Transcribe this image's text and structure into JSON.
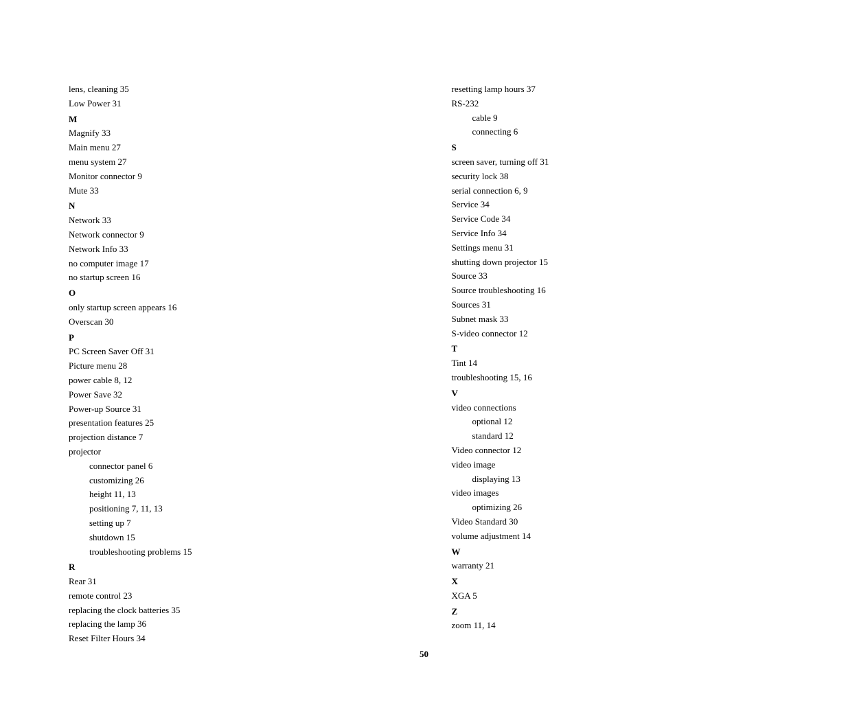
{
  "page": {
    "number": "50"
  },
  "left_column": [
    {
      "text": "lens, cleaning 35",
      "type": "normal"
    },
    {
      "text": "Low Power 31",
      "type": "normal"
    },
    {
      "text": "M",
      "type": "letter-heading"
    },
    {
      "text": "Magnify 33",
      "type": "normal"
    },
    {
      "text": "Main menu 27",
      "type": "normal"
    },
    {
      "text": "menu system 27",
      "type": "normal"
    },
    {
      "text": "Monitor connector 9",
      "type": "normal"
    },
    {
      "text": "Mute 33",
      "type": "normal"
    },
    {
      "text": "N",
      "type": "letter-heading"
    },
    {
      "text": "Network 33",
      "type": "normal"
    },
    {
      "text": "Network connector 9",
      "type": "normal"
    },
    {
      "text": "Network Info 33",
      "type": "normal"
    },
    {
      "text": "no computer image 17",
      "type": "normal"
    },
    {
      "text": "no startup screen 16",
      "type": "normal"
    },
    {
      "text": "O",
      "type": "letter-heading"
    },
    {
      "text": "only startup screen appears 16",
      "type": "normal"
    },
    {
      "text": "Overscan 30",
      "type": "normal"
    },
    {
      "text": "P",
      "type": "letter-heading"
    },
    {
      "text": "PC Screen Saver Off 31",
      "type": "normal"
    },
    {
      "text": "Picture menu 28",
      "type": "normal"
    },
    {
      "text": "power cable 8, 12",
      "type": "normal"
    },
    {
      "text": "Power Save 32",
      "type": "normal"
    },
    {
      "text": "Power-up Source 31",
      "type": "normal"
    },
    {
      "text": "presentation features 25",
      "type": "normal"
    },
    {
      "text": "projection distance 7",
      "type": "normal"
    },
    {
      "text": "projector",
      "type": "normal"
    },
    {
      "text": "connector panel 6",
      "type": "sub-entry"
    },
    {
      "text": "customizing 26",
      "type": "sub-entry"
    },
    {
      "text": "height 11, 13",
      "type": "sub-entry"
    },
    {
      "text": "positioning 7, 11, 13",
      "type": "sub-entry"
    },
    {
      "text": "setting up 7",
      "type": "sub-entry"
    },
    {
      "text": "shutdown 15",
      "type": "sub-entry"
    },
    {
      "text": "troubleshooting problems 15",
      "type": "sub-entry"
    },
    {
      "text": "R",
      "type": "letter-heading"
    },
    {
      "text": "Rear 31",
      "type": "normal"
    },
    {
      "text": "remote control 23",
      "type": "normal"
    },
    {
      "text": "replacing the clock batteries 35",
      "type": "normal"
    },
    {
      "text": "replacing the lamp 36",
      "type": "normal"
    },
    {
      "text": "Reset Filter Hours 34",
      "type": "normal"
    }
  ],
  "right_column": [
    {
      "text": "resetting lamp hours 37",
      "type": "normal"
    },
    {
      "text": "RS-232",
      "type": "normal"
    },
    {
      "text": "cable 9",
      "type": "sub-entry"
    },
    {
      "text": "connecting 6",
      "type": "sub-entry"
    },
    {
      "text": "S",
      "type": "letter-heading"
    },
    {
      "text": "screen saver, turning off 31",
      "type": "normal"
    },
    {
      "text": "security lock 38",
      "type": "normal"
    },
    {
      "text": "serial connection 6, 9",
      "type": "normal"
    },
    {
      "text": "Service 34",
      "type": "normal"
    },
    {
      "text": "Service Code 34",
      "type": "normal"
    },
    {
      "text": "Service Info 34",
      "type": "normal"
    },
    {
      "text": "Settings menu 31",
      "type": "normal"
    },
    {
      "text": "shutting down projector 15",
      "type": "normal"
    },
    {
      "text": "Source 33",
      "type": "normal"
    },
    {
      "text": "Source troubleshooting 16",
      "type": "normal"
    },
    {
      "text": "Sources 31",
      "type": "normal"
    },
    {
      "text": "Subnet mask 33",
      "type": "normal"
    },
    {
      "text": "S-video connector 12",
      "type": "normal"
    },
    {
      "text": "T",
      "type": "letter-heading"
    },
    {
      "text": "Tint 14",
      "type": "normal"
    },
    {
      "text": "troubleshooting 15, 16",
      "type": "normal"
    },
    {
      "text": "V",
      "type": "letter-heading"
    },
    {
      "text": "video connections",
      "type": "normal"
    },
    {
      "text": "optional 12",
      "type": "sub-entry"
    },
    {
      "text": "standard 12",
      "type": "sub-entry"
    },
    {
      "text": "Video connector 12",
      "type": "normal"
    },
    {
      "text": "video image",
      "type": "normal"
    },
    {
      "text": "displaying 13",
      "type": "sub-entry"
    },
    {
      "text": "video images",
      "type": "normal"
    },
    {
      "text": "optimizing 26",
      "type": "sub-entry"
    },
    {
      "text": "Video Standard 30",
      "type": "normal"
    },
    {
      "text": "volume adjustment 14",
      "type": "normal"
    },
    {
      "text": "W",
      "type": "letter-heading"
    },
    {
      "text": "warranty 21",
      "type": "normal"
    },
    {
      "text": "X",
      "type": "letter-heading"
    },
    {
      "text": "XGA 5",
      "type": "normal"
    },
    {
      "text": "Z",
      "type": "letter-heading"
    },
    {
      "text": "zoom 11, 14",
      "type": "normal"
    }
  ]
}
